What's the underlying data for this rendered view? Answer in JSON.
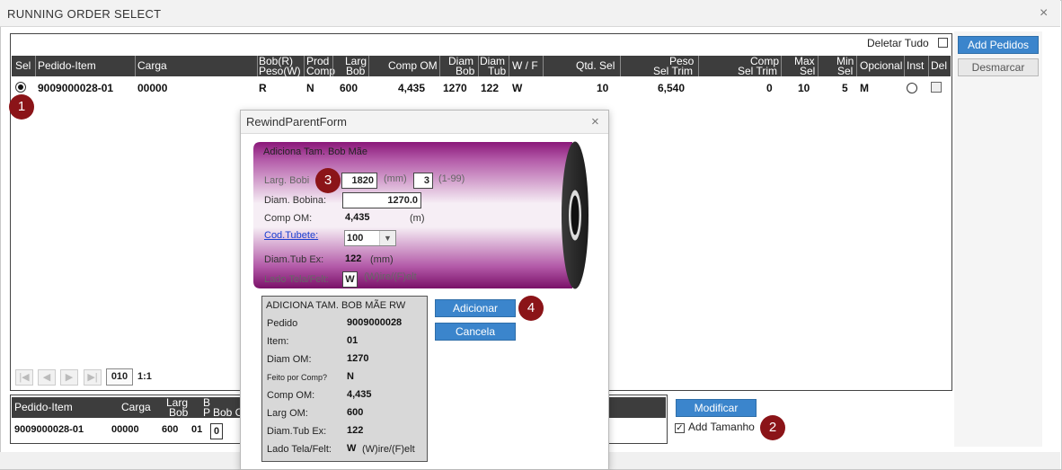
{
  "window": {
    "title": "RUNNING ORDER SELECT",
    "close": "×"
  },
  "toolbar": {
    "deletar_tudo": "Deletar Tudo",
    "add_pedidos": "Add Pedidos",
    "desmarcar": "Desmarcar"
  },
  "grid": {
    "headers": {
      "sel": "Sel",
      "pedido_item": "Pedido-Item",
      "carga": "Carga",
      "bob_r": "Bob(R)",
      "peso_w": "Peso(W)",
      "prod": "Prod",
      "comp": "Comp",
      "larg": "Larg",
      "bob1": "Bob",
      "comp_om": "Comp OM",
      "diam": "Diam",
      "bob2": "Bob",
      "diam2": "Diam",
      "tub": "Tub",
      "wf": "W / F",
      "qtd_sel": "Qtd. Sel",
      "peso": "Peso",
      "sel_trim": "Sel Trim",
      "comp2": "Comp",
      "sel_trim2": "Sel Trim",
      "max": "Max",
      "sel_max": "Sel",
      "min": "Min",
      "sel_min": "Sel",
      "opcional": "Opcional",
      "inst": "Inst",
      "del": "Del"
    },
    "row": {
      "pedido_item": "9009000028-01",
      "carga": "00000",
      "bob_peso": "R",
      "prod_comp": "N",
      "larg_bob": "600",
      "comp_om": "4,435",
      "diam_bob": "1270",
      "diam_tub": "122",
      "wf": "W",
      "qtd_sel": "10",
      "peso_sel_trim": "6,540",
      "comp_sel_trim": "0",
      "max_sel": "10",
      "min_sel": "5",
      "opcional": "M"
    },
    "pager": {
      "page": "010",
      "ratio": "1:1"
    }
  },
  "bottom_grid": {
    "headers": {
      "pedido_item": "Pedido-Item",
      "carga": "Carga",
      "larg": "Larg",
      "bob": "Bob",
      "b": "B",
      "p": "P",
      "bob_c": "Bob C"
    },
    "row": {
      "pedido_item": "9009000028-01",
      "carga": "00000",
      "larg": "600",
      "b": "01",
      "qty": "0"
    }
  },
  "modificar": "Modificar",
  "add_tamanho": "Add Tamanho",
  "markers": [
    "1",
    "2",
    "3",
    "4"
  ],
  "dialog": {
    "title": "RewindParentForm",
    "close": "×",
    "roll_title": "Adiciona Tam. Bob Mãe",
    "larg_bobina_label": "Larg. Bobi",
    "larg_bobina_value": "1820",
    "larg_unit": "(mm)",
    "qty_value": "3",
    "qty_range": "(1-99)",
    "diam_bobina_label": "Diam. Bobina:",
    "diam_bobina_value": "1270.0",
    "comp_om_label": "Comp OM:",
    "comp_om_value": "4,435",
    "comp_om_unit": "(m)",
    "cod_tubete_label": "Cod.Tubete:",
    "cod_tubete_value": "100",
    "diam_tub_label": "Diam.Tub Ex:",
    "diam_tub_value": "122",
    "diam_tub_unit": "(mm)",
    "lado_label": "Lado Tela/Felt:",
    "lado_value": "W",
    "lado_hint": "(W)ire/(F)elt",
    "adicionar": "Adicionar",
    "cancela": "Cancela",
    "roll_color": "#9a1f8c"
  },
  "summary": {
    "title": "ADICIONA TAM. BOB MÃE RW",
    "pedido_label": "Pedido",
    "pedido": "9009000028",
    "item_label": "Item:",
    "item": "01",
    "diam_om_label": "Diam OM:",
    "diam_om": "1270",
    "feito_label": "Feito por Comp?",
    "feito": "N",
    "comp_om_label": "Comp OM:",
    "comp_om": "4,435",
    "larg_om_label": "Larg OM:",
    "larg_om": "600",
    "diam_tub_label": "Diam.Tub Ex:",
    "diam_tub": "122",
    "lado_label": "Lado Tela/Felt:",
    "lado": "W",
    "lado_hint": "(W)ire/(F)elt"
  }
}
